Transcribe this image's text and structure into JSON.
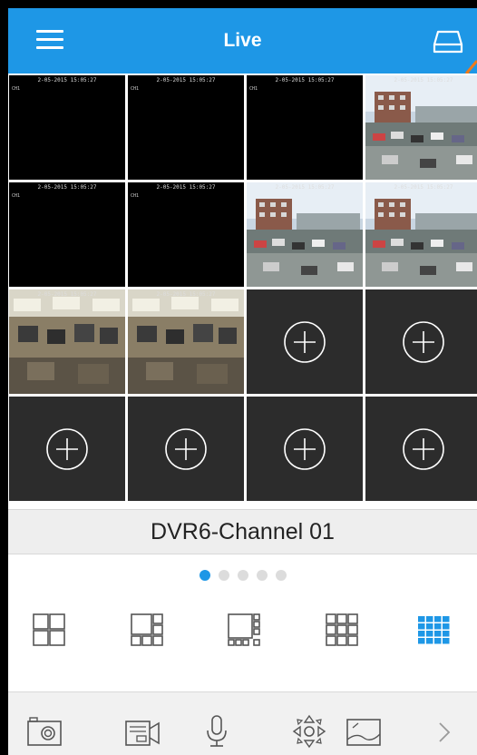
{
  "header": {
    "title": "Live",
    "menu_icon": "hamburger-menu-icon",
    "device_icon": "storage-device-icon"
  },
  "grid": {
    "timestamp": "2-05-2015 15:05:27",
    "channel_tag": "CH1",
    "tiles": [
      {
        "kind": "black"
      },
      {
        "kind": "black"
      },
      {
        "kind": "black"
      },
      {
        "kind": "outdoor"
      },
      {
        "kind": "black"
      },
      {
        "kind": "black"
      },
      {
        "kind": "outdoor"
      },
      {
        "kind": "outdoor"
      },
      {
        "kind": "indoor"
      },
      {
        "kind": "indoor"
      },
      {
        "kind": "empty"
      },
      {
        "kind": "empty"
      },
      {
        "kind": "empty"
      },
      {
        "kind": "empty"
      },
      {
        "kind": "empty"
      },
      {
        "kind": "empty"
      }
    ]
  },
  "channel_bar": {
    "name": "DVR6-Channel 01"
  },
  "pager": {
    "count": 5,
    "active_index": 0
  },
  "layouts": [
    {
      "name": "layout-1x4",
      "active": false
    },
    {
      "name": "layout-6",
      "active": false
    },
    {
      "name": "layout-8",
      "active": false
    },
    {
      "name": "layout-9",
      "active": false
    },
    {
      "name": "layout-16",
      "active": true
    }
  ],
  "toolbar": [
    {
      "name": "snapshot-button",
      "icon": "camera-icon"
    },
    {
      "name": "record-button",
      "icon": "video-record-icon"
    },
    {
      "name": "talk-button",
      "icon": "microphone-icon"
    },
    {
      "name": "ptz-button",
      "icon": "ptz-control-icon"
    },
    {
      "name": "image-quality-button",
      "icon": "image-icon"
    },
    {
      "name": "more-button",
      "icon": "chevron-right-icon"
    }
  ],
  "colors": {
    "header_bg": "#1e97e6",
    "active_dot": "#1e97e6",
    "active_layout": "#1e97e6",
    "inactive_icon": "#555555",
    "empty_tile": "#2c2c2c",
    "orange_accent": "#f07a1a"
  }
}
